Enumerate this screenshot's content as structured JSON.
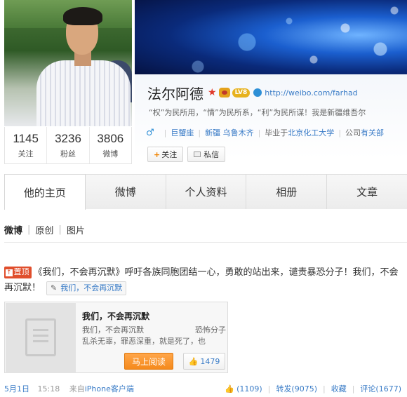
{
  "profile": {
    "name": "法尔阿德",
    "level_badge": "LV8",
    "url": "http://weibo.com/farhad",
    "bio": "“权”为民所用，“情”为民所系，“利”为民所谋！我是新疆维吾尔",
    "zodiac": "巨蟹座",
    "location": "新疆  乌鲁木齐",
    "school_prefix": "毕业于",
    "school": "北京化工大学",
    "company_prefix": "公司",
    "company": "有关部",
    "follow_label": "关注",
    "message_label": "私信"
  },
  "stats": [
    {
      "num": "1145",
      "label": "关注"
    },
    {
      "num": "3236",
      "label": "粉丝"
    },
    {
      "num": "3806",
      "label": "微博"
    }
  ],
  "tabs": [
    "他的主页",
    "微博",
    "个人资料",
    "相册",
    "文章"
  ],
  "subtabs": [
    "微博",
    "原创",
    "图片"
  ],
  "post": {
    "pin_label": "置顶",
    "text": "《我们，不会再沉默》呼吁各族同胞团结一心，勇敢的站出来，谴责暴恐分子！我们，不会再沉默！",
    "topic": "我们，不会再沉默",
    "card_title": "我们，不会再沉默",
    "card_line1_left": "我们，不会再沉默",
    "card_line1_right": "恐怖分子",
    "card_line2": "乱杀无辜，罪恶深重，就是死了，也",
    "read_label": "马上阅读",
    "likes": "1479",
    "date": "5月1日",
    "time": "15:18",
    "source_prefix": "来自",
    "source": "iPhone客户端",
    "like_count": "(1109)",
    "repost": "转发(9075)",
    "favorite": "收藏",
    "comment": "评论(1677)"
  },
  "colors": {
    "link": "#3a7cc7",
    "accent": "#f58a1c",
    "pin": "#e04e2c"
  }
}
